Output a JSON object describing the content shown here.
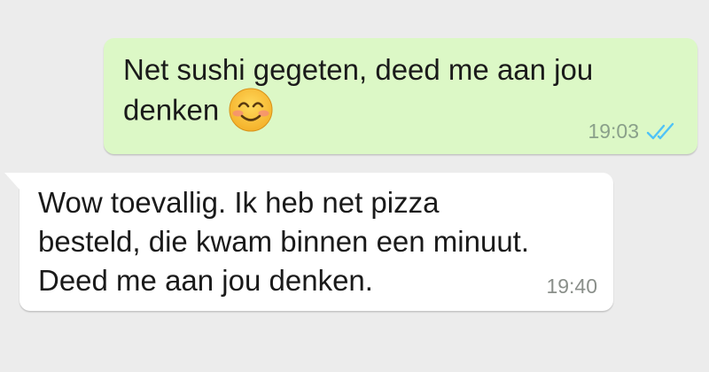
{
  "messages": [
    {
      "direction": "outgoing",
      "text": "Net sushi gegeten, deed me aan jou\ndenken",
      "emoji": "smiling-face-icon",
      "time": "19:03",
      "status_icon": "double-check-read-icon",
      "bubble_color": "#dcf8c6",
      "status_color": "#4fc3f7"
    },
    {
      "direction": "incoming",
      "text": "Wow toevallig. Ik heb net pizza\nbesteld, die kwam binnen een minuut.\nDeed me aan jou denken.",
      "time": "19:40",
      "bubble_color": "#ffffff"
    }
  ],
  "background_color": "#ececec"
}
